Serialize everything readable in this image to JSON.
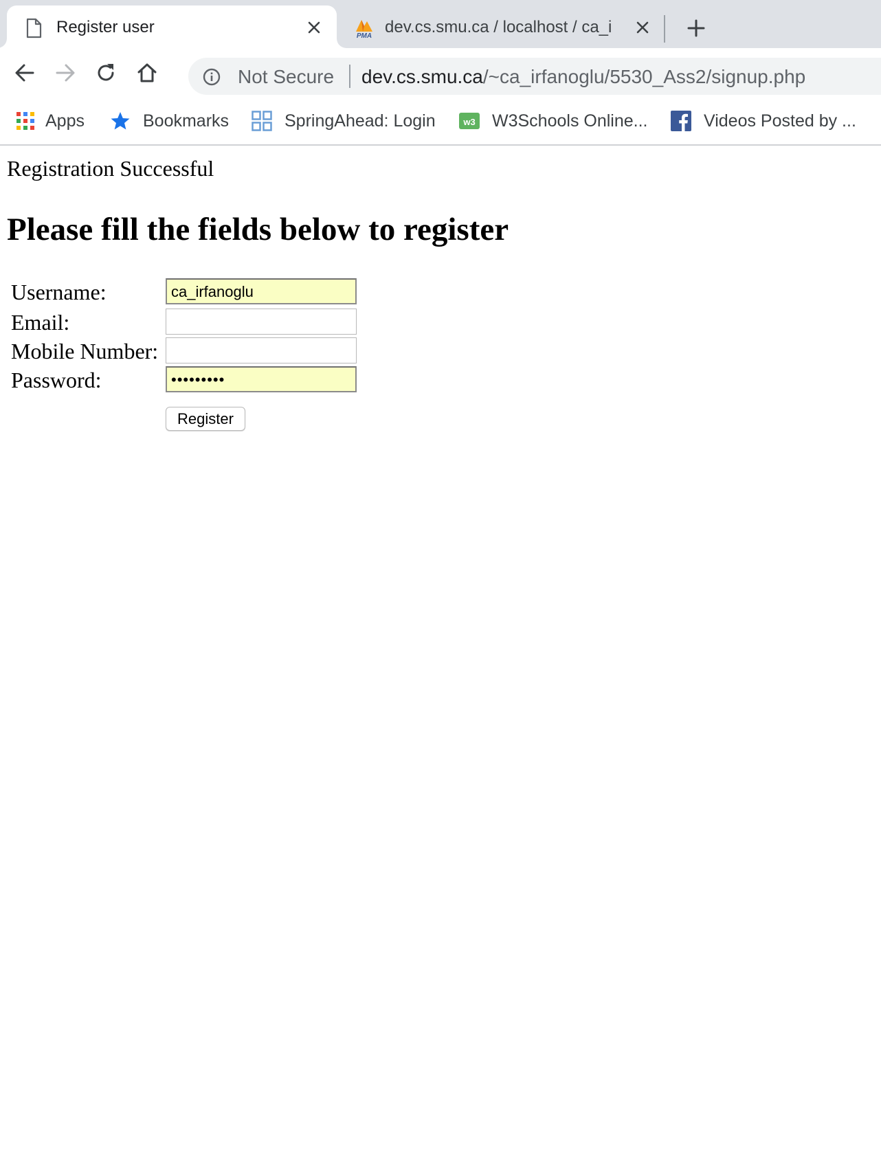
{
  "browser": {
    "tabs": [
      {
        "title": "Register user",
        "icon": "page-icon",
        "active": true
      },
      {
        "title": "dev.cs.smu.ca / localhost / ca_i",
        "icon": "phpmyadmin-logo-icon",
        "icon_text": "PMA",
        "active": false
      }
    ],
    "toolbar": {
      "security_label": "Not Secure",
      "url_host": "dev.cs.smu.ca",
      "url_path": "/~ca_irfanoglu/5530_Ass2/signup.php"
    },
    "bookmarks": [
      {
        "label": "Apps",
        "icon": "apps-grid-icon"
      },
      {
        "label": "Bookmarks",
        "icon": "star-icon"
      },
      {
        "label": "SpringAhead: Login",
        "icon": "springahead-icon"
      },
      {
        "label": "W3Schools Online...",
        "icon": "w3schools-icon"
      },
      {
        "label": "Videos Posted by ...",
        "icon": "facebook-icon"
      }
    ]
  },
  "page": {
    "status_message": "Registration Successful",
    "heading": "Please fill the fields below to register",
    "form": {
      "username": {
        "label": "Username:",
        "value": "ca_irfanoglu"
      },
      "email": {
        "label": "Email:",
        "value": ""
      },
      "mobile": {
        "label": "Mobile Number:",
        "value": ""
      },
      "password": {
        "label": "Password:",
        "value": "•••••••••"
      },
      "submit_label": "Register"
    }
  },
  "colors": {
    "tabstrip_bg": "#dee1e6",
    "omnibox_bg": "#f1f3f4",
    "autofill_bg": "#fafec4",
    "bookmark_star": "#1a73e8",
    "facebook_blue": "#3b5998",
    "w3schools_green": "#5fb35f"
  }
}
